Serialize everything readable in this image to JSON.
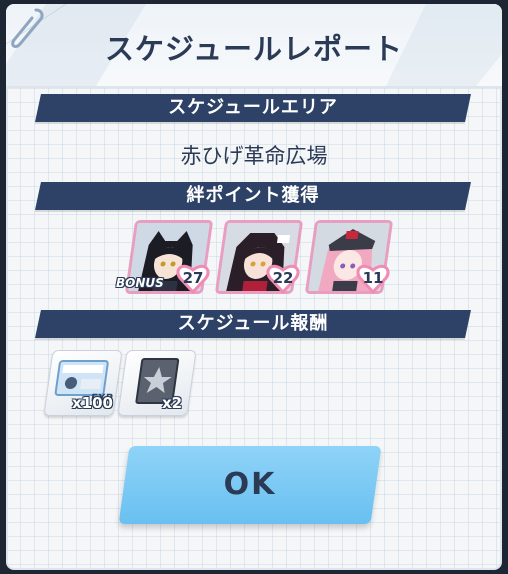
{
  "dialog": {
    "title": "スケジュールレポート",
    "ok_label": "OK"
  },
  "schedule_area": {
    "header": "スケジュールエリア",
    "name": "赤ひげ革命広場"
  },
  "bond_points": {
    "header": "絆ポイント獲得",
    "bonus_label": "BONUS",
    "students": [
      {
        "value": "27",
        "icon": "student-portrait-black-hair-cat-ears"
      },
      {
        "value": "22",
        "icon": "student-portrait-dark-hair-ribbon"
      },
      {
        "value": "11",
        "icon": "student-portrait-pink-hair-cap"
      }
    ]
  },
  "rewards": {
    "header": "スケジュール報酬",
    "items": [
      {
        "quantity": "x100",
        "icon": "exp-report-icon"
      },
      {
        "quantity": "x2",
        "icon": "tech-note-book-icon"
      }
    ]
  },
  "colors": {
    "section_bar": "#2d4266",
    "text_dark": "#2b3a55",
    "ok_button": "#69c0f0",
    "portrait_border": "#e79ec0",
    "heart": "#f08bb4"
  }
}
